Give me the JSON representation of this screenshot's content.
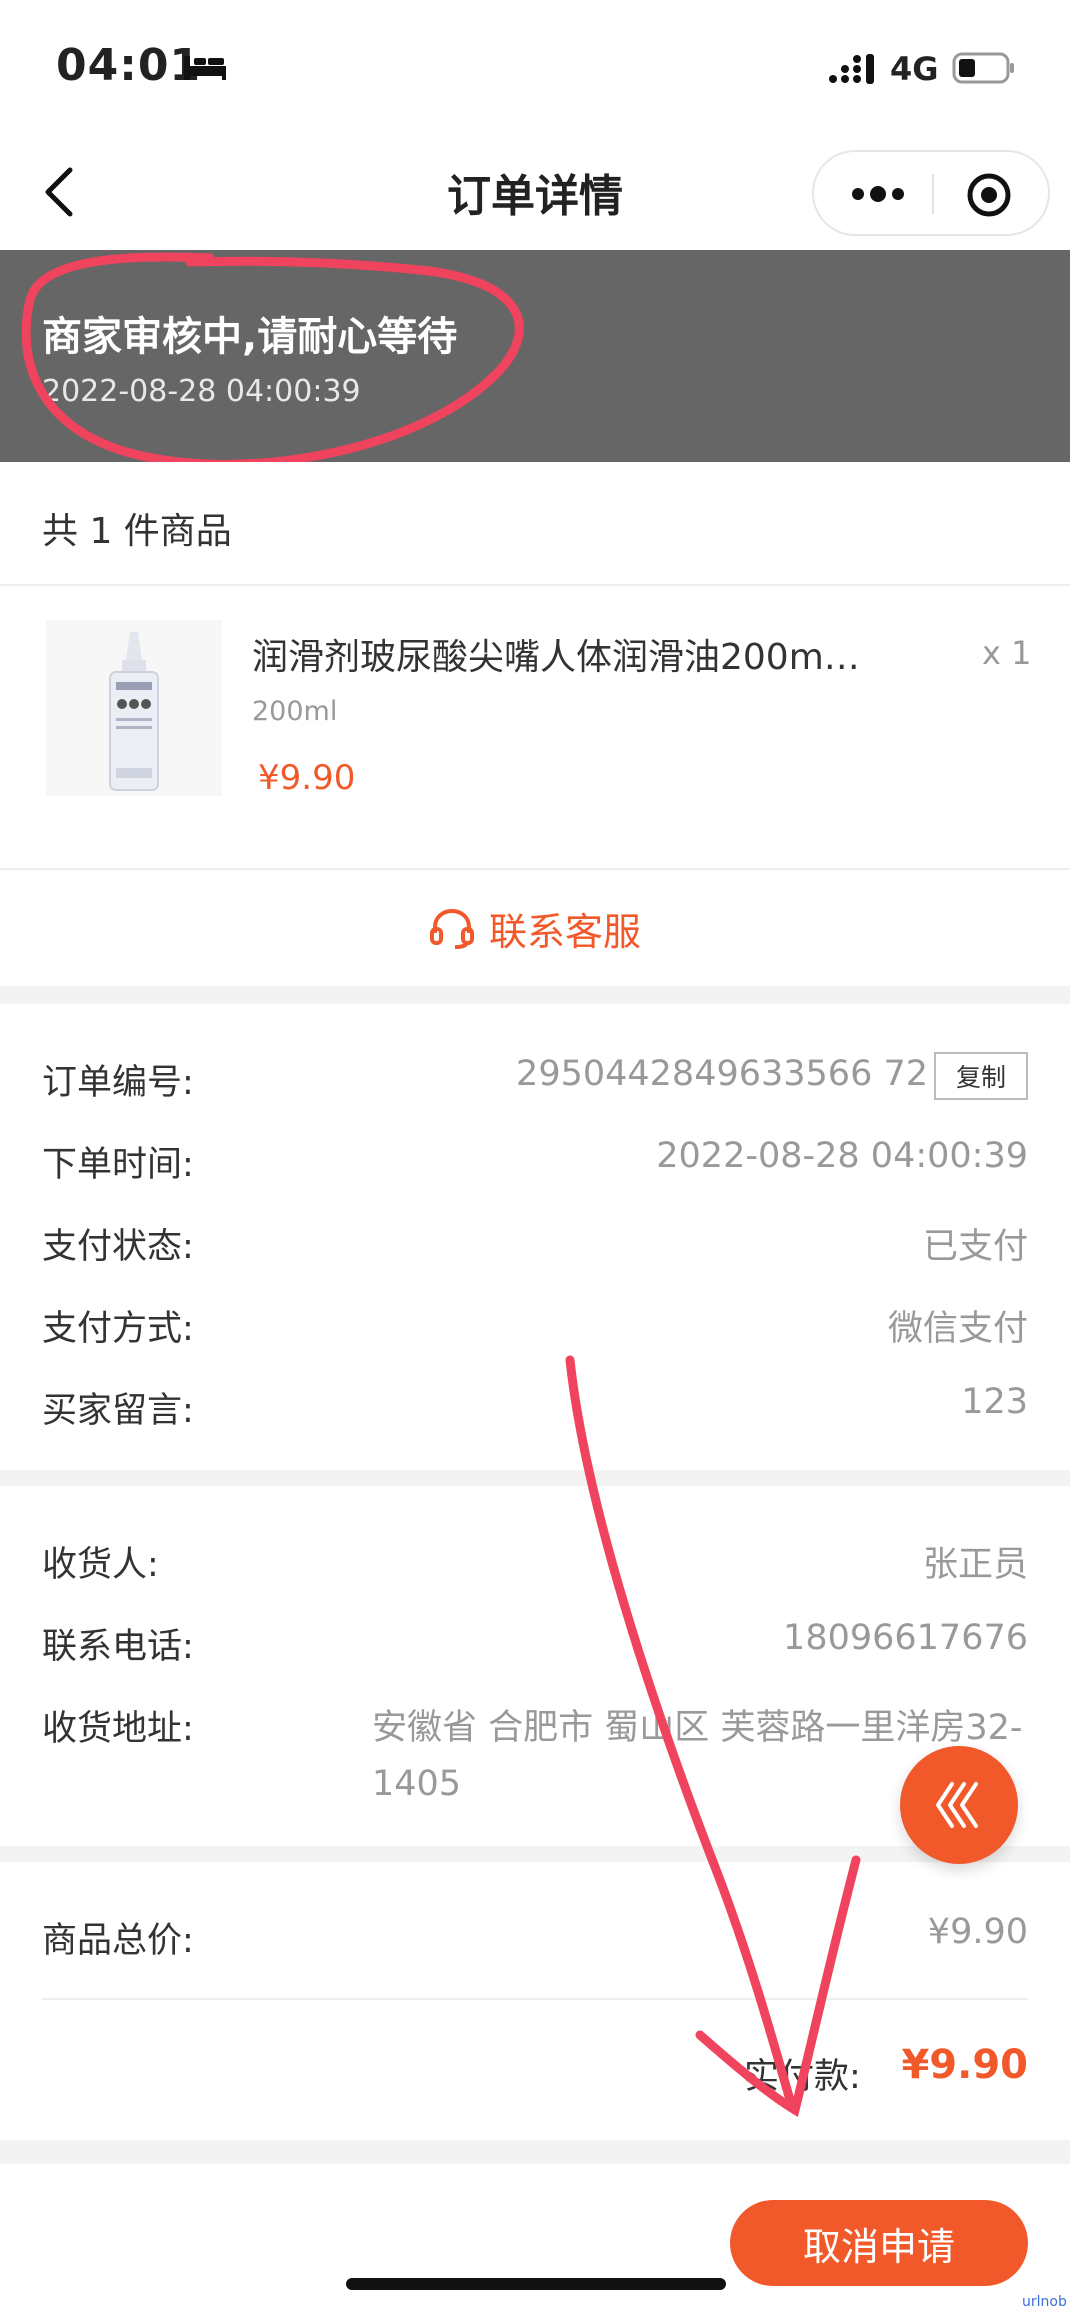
{
  "status_bar": {
    "time": "04:01",
    "network": "4G"
  },
  "nav": {
    "title": "订单详情"
  },
  "banner": {
    "status": "商家审核中,请耐心等待",
    "time": "2022-08-28   04:00:39"
  },
  "goods": {
    "count_text": "共 1 件商品",
    "name": "润滑剂玻尿酸尖嘴人体润滑油200m…",
    "spec": "200ml",
    "price": "¥9.90",
    "quantity": "x 1",
    "contact_label": "联系客服"
  },
  "order_info": {
    "order_no": {
      "label": "订单编号:",
      "value": "2950442849633566 72",
      "copy_label": "复制"
    },
    "order_time": {
      "label": "下单时间:",
      "value": "2022-08-28 04:00:39"
    },
    "pay_status": {
      "label": "支付状态:",
      "value": "已支付"
    },
    "pay_method": {
      "label": "支付方式:",
      "value": "微信支付"
    },
    "buyer_note": {
      "label": "买家留言:",
      "value": "123"
    }
  },
  "receiver": {
    "name": {
      "label": "收货人:",
      "value": "张正员"
    },
    "phone": {
      "label": "联系电话:",
      "value": "18096617676"
    },
    "address": {
      "label": "收货地址:",
      "value": "安徽省 合肥市 蜀山区 芙蓉路一里洋房32-1405"
    }
  },
  "price": {
    "total": {
      "label": "商品总价:",
      "value": "¥9.90"
    },
    "actual": {
      "label": "实付款:",
      "value": "¥9.90"
    }
  },
  "footer": {
    "cancel_label": "取消申请",
    "watermark": "urlnob"
  },
  "colors": {
    "accent": "#f1592a",
    "banner": "#666666",
    "annotation": "#f0435e"
  },
  "icons": [
    "bed-icon",
    "signal-icon",
    "battery-icon",
    "back-icon",
    "more-icon",
    "close-mini-icon",
    "headset-icon",
    "float-arrows-icon"
  ]
}
